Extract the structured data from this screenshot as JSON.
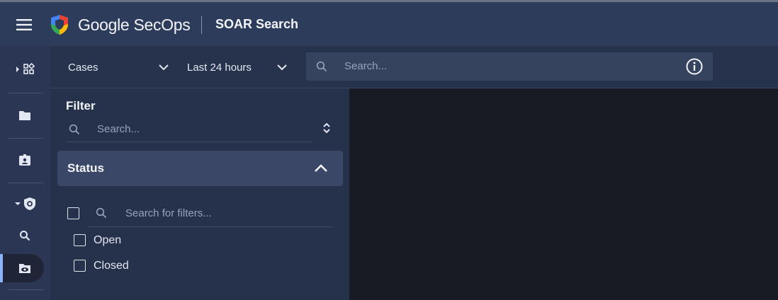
{
  "header": {
    "brand": "Google SecOps",
    "product": "SOAR Search"
  },
  "rail": {
    "items": [
      {
        "name": "dashboards",
        "icon": "apps-icon"
      },
      {
        "name": "cases",
        "icon": "folder-icon"
      },
      {
        "name": "detections",
        "icon": "badge-icon"
      },
      {
        "name": "investigation",
        "icon": "shield-icon"
      },
      {
        "name": "search",
        "icon": "search-icon"
      },
      {
        "name": "soar-search",
        "icon": "folder-eye-icon",
        "active": true
      }
    ]
  },
  "toolbar": {
    "entity_type": "Cases",
    "time_range": "Last 24 hours",
    "search_placeholder": "Search..."
  },
  "filter": {
    "title": "Filter",
    "search_placeholder": "Search...",
    "sections": [
      {
        "label": "Status",
        "expanded": true,
        "search_placeholder": "Search for filters...",
        "options": [
          {
            "label": "Open",
            "checked": false
          },
          {
            "label": "Closed",
            "checked": false
          }
        ]
      }
    ]
  },
  "colors": {
    "header_bg": "#2e3c5c",
    "panel_bg": "#26314b",
    "accent": "#8ab4f8",
    "content_bg": "#181a24"
  }
}
